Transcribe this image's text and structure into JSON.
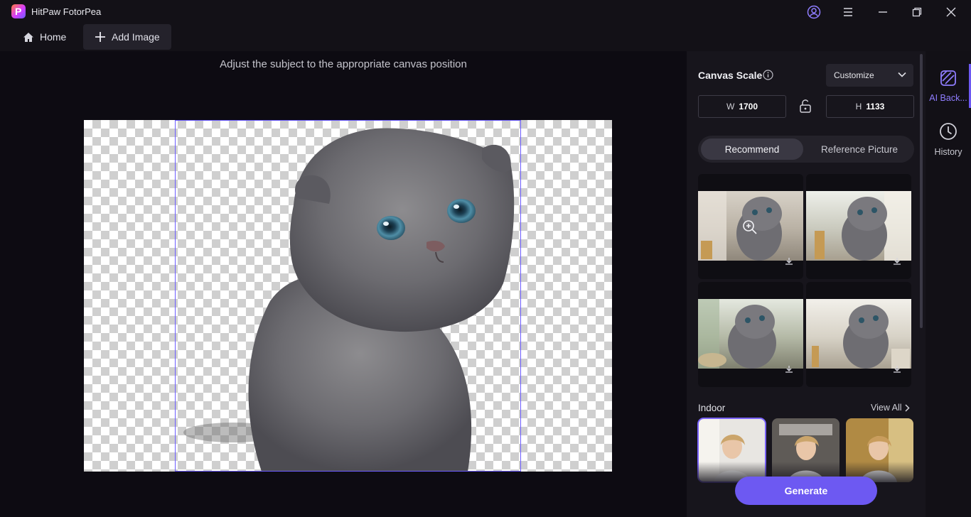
{
  "app": {
    "title": "HitPaw FotorPea",
    "logo_letter": "P"
  },
  "tabs": {
    "home": "Home",
    "add_image": "Add Image"
  },
  "workspace": {
    "hint": "Adjust the subject to the appropriate canvas position"
  },
  "panel": {
    "canvas_scale_label": "Canvas Scale",
    "scale_select_value": "Customize",
    "width_prefix": "W",
    "width_value": "1700",
    "height_prefix": "H",
    "height_value": "1133",
    "segment": {
      "recommend": "Recommend",
      "reference": "Reference Picture"
    },
    "indoor_label": "Indoor",
    "view_all": "View All",
    "generate": "Generate"
  },
  "rail": {
    "ai_background": "AI Back...",
    "history": "History"
  },
  "colors": {
    "accent": "#6d59f2",
    "accent_text": "#8f7dff",
    "frame": "#6c5cff",
    "panel_bg": "#17151c"
  }
}
